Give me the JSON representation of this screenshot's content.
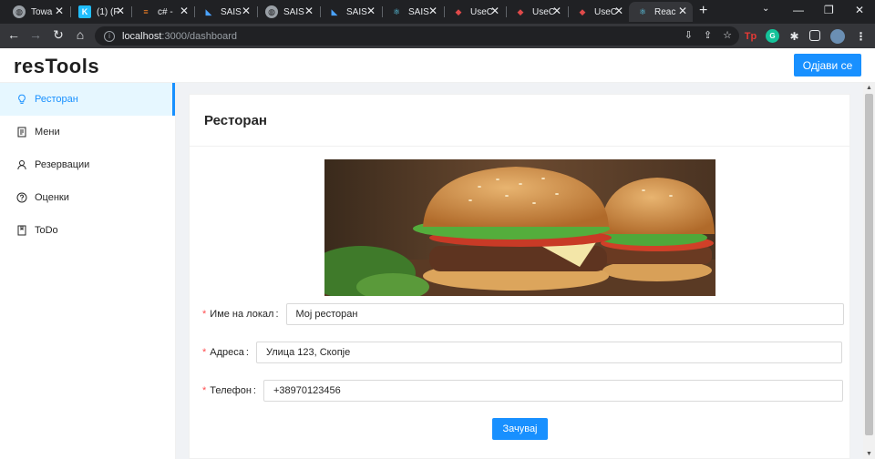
{
  "browser": {
    "tabs": [
      {
        "label": "Towa",
        "icon": "globe-icon"
      },
      {
        "label": "(1) (F",
        "icon": "kaggle-icon"
      },
      {
        "label": "c# - ",
        "icon": "stackoverflow-icon"
      },
      {
        "label": "SAIS",
        "icon": "azure-devops-icon"
      },
      {
        "label": "SAIS",
        "icon": "globe-icon"
      },
      {
        "label": "SAIS",
        "icon": "azure-devops-icon"
      },
      {
        "label": "SAIS",
        "icon": "react-icon"
      },
      {
        "label": "UseC",
        "icon": "reactjs-site-icon"
      },
      {
        "label": "UseC",
        "icon": "reactjs-site-icon"
      },
      {
        "label": "UseC",
        "icon": "reactjs-site-icon"
      },
      {
        "label": "Reac",
        "icon": "react-icon",
        "active": true
      }
    ],
    "url_host": "localhost",
    "url_path": ":3000/dashboard"
  },
  "app": {
    "logo": "resTools",
    "logout_label": "Одјави се"
  },
  "sidebar": {
    "items": [
      {
        "label": "Ресторан",
        "icon": "bulb-icon",
        "active": true
      },
      {
        "label": "Мени",
        "icon": "menu-book-icon"
      },
      {
        "label": "Резервации",
        "icon": "user-icon"
      },
      {
        "label": "Оценки",
        "icon": "question-circle-icon"
      },
      {
        "label": "ToDo",
        "icon": "book-icon"
      }
    ]
  },
  "card": {
    "title": "Ресторан",
    "image": "burger-photo",
    "form": {
      "name_label": "Име на локал",
      "name_value": "Мој ресторан",
      "address_label": "Адреса",
      "address_value": "Улица 123, Скопје",
      "phone_label": "Телефон",
      "phone_value": "+38970123456",
      "save_label": "Зачувај"
    }
  },
  "colors": {
    "primary": "#1890ff",
    "required": "#ff4d4f",
    "content_bg": "#f0f2f5"
  }
}
